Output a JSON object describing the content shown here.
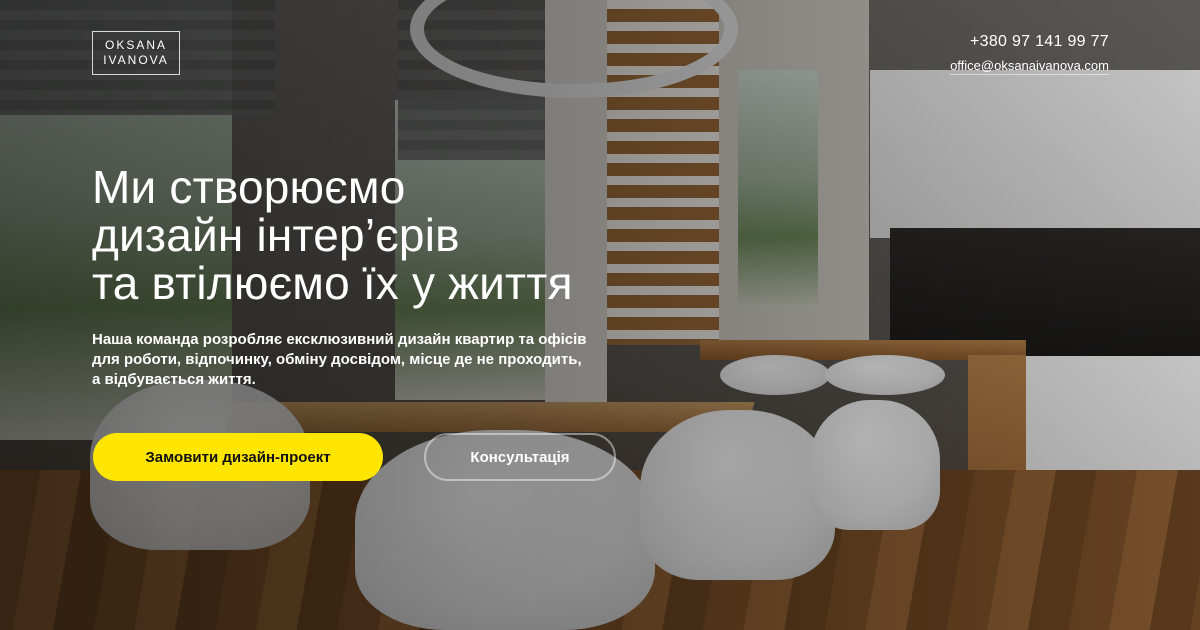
{
  "brand": {
    "logo_line1": "OKSANA",
    "logo_line2": "IVANOVA"
  },
  "contacts": {
    "phone": "+380 97 141 99 77",
    "email": "office@oksanaivanova.com"
  },
  "hero": {
    "headline_lines": [
      "Ми створюємо",
      "дизайн інтер’єрів",
      "та втілюємо їх у життя"
    ],
    "subtext_lines": [
      "Наша команда розробляє ексклюзивний дизайн квартир та офісів",
      "для роботи, відпочинку, обміну досвідом, місце де не проходить,",
      "а відбувається життя."
    ]
  },
  "actions": {
    "order_design": "Замовити дизайн-проект",
    "consultation": "Консультація"
  },
  "colors": {
    "accent": "#ffe600",
    "text": "#ffffff"
  }
}
